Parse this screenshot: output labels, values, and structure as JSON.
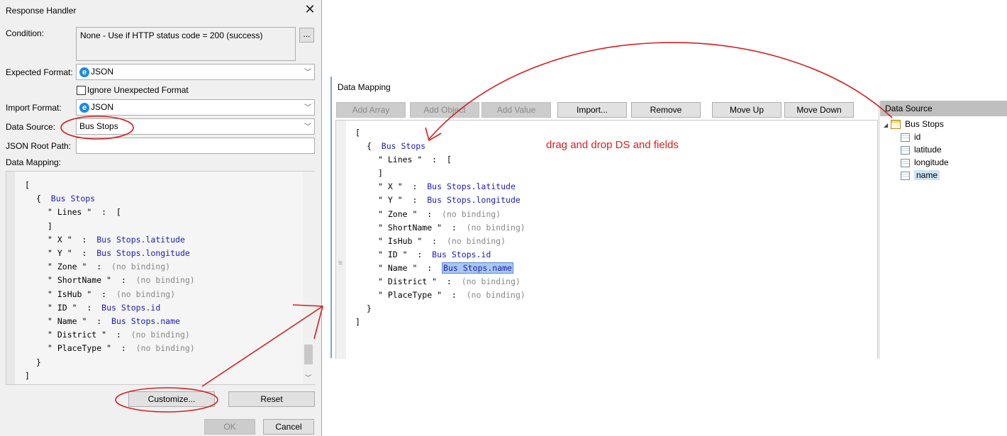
{
  "dialog": {
    "title": "Response Handler",
    "condition_label": "Condition:",
    "condition_value": "None - Use if HTTP status code = 200 (success)",
    "ellipsis_label": "...",
    "expected_format_label": "Expected Format:",
    "expected_format_value": "JSON",
    "ignore_unexpected_label": "Ignore Unexpected Format",
    "import_format_label": "Import Format:",
    "import_format_value": "JSON",
    "data_source_label": "Data Source:",
    "data_source_value": "Bus Stops",
    "json_root_label": "JSON Root Path:",
    "json_root_value": "",
    "data_mapping_label": "Data Mapping:",
    "customize_label": "Customize...",
    "reset_label": "Reset",
    "ok_label": "OK",
    "cancel_label": "Cancel"
  },
  "mapping": {
    "open_bracket": "[",
    "object_open": "{",
    "object_name": "Bus Stops",
    "lines_key": "\" Lines \"  :  [",
    "lines_close": "]",
    "rows": [
      {
        "key": "\" X \"  :  ",
        "value": "Bus Stops.latitude",
        "bound": true
      },
      {
        "key": "\" Y \"  :  ",
        "value": "Bus Stops.longitude",
        "bound": true
      },
      {
        "key": "\" Zone \"  :  ",
        "value": "(no binding)",
        "bound": false
      },
      {
        "key": "\" ShortName \"  :  ",
        "value": "(no binding)",
        "bound": false
      },
      {
        "key": "\" IsHub \"  :  ",
        "value": "(no binding)",
        "bound": false
      },
      {
        "key": "\" ID \"  :  ",
        "value": "Bus Stops.id",
        "bound": true
      },
      {
        "key": "\" Name \"  :  ",
        "value": "Bus Stops.name",
        "bound": true
      },
      {
        "key": "\" District \"  :  ",
        "value": "(no binding)",
        "bound": false
      },
      {
        "key": "\" PlaceType \"  :  ",
        "value": "(no binding)",
        "bound": false
      }
    ],
    "object_close": "}",
    "close_bracket": "]"
  },
  "editor": {
    "title": "Data Mapping",
    "toolbar": [
      "Add Array",
      "Add Object",
      "Add Value",
      "Import...",
      "Remove",
      "Move Up",
      "Move Down"
    ],
    "toolbar_disabled": [
      true,
      true,
      true,
      false,
      false,
      false,
      false
    ],
    "annotation": "drag and drop DS and fields",
    "gutter_glyph": "≡",
    "selected_row": "Name"
  },
  "data_source_panel": {
    "header": "Data Source",
    "root": "Bus Stops",
    "fields": [
      "id",
      "latitude",
      "longitude",
      "name"
    ],
    "selected_field": "name"
  },
  "colors": {
    "annotation_red": "#d42020",
    "dialog_bg": "#f0f0f0",
    "binding_blue": "#1a1ab4",
    "selection_blue": "#a8c8f0"
  }
}
